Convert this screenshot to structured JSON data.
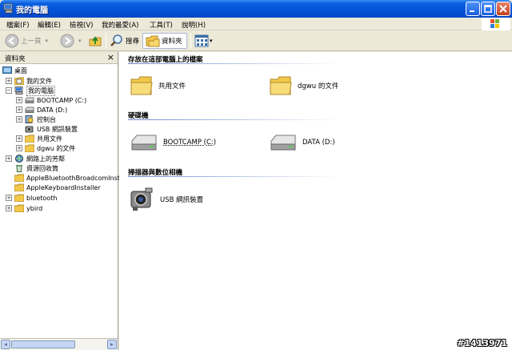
{
  "window": {
    "title": "我的電腦"
  },
  "menu": [
    "檔案(F)",
    "編輯(E)",
    "檢視(V)",
    "我的最愛(A)",
    "工具(T)",
    "說明(H)"
  ],
  "toolbar": {
    "back_label": "上一頁",
    "search_label": "搜尋",
    "folders_label": "資料夾"
  },
  "folders_pane": {
    "title": "資料夾",
    "close_glyph": "×",
    "tree": [
      {
        "label": "桌面",
        "expander": "",
        "icon": "desktop-icon"
      },
      {
        "label": "我的文件",
        "expander": "+",
        "icon": "my-documents-icon"
      },
      {
        "label": "我的電腦",
        "expander": "−",
        "icon": "my-computer-icon",
        "selected": true
      },
      {
        "label": "BOOTCAMP (C:)",
        "expander": "+",
        "icon": "drive-icon"
      },
      {
        "label": "DATA (D:)",
        "expander": "+",
        "icon": "drive-icon"
      },
      {
        "label": "控制台",
        "expander": "+",
        "icon": "control-panel-icon"
      },
      {
        "label": "USB 網訊裝置",
        "expander": "",
        "icon": "camera-icon"
      },
      {
        "label": "共用文件",
        "expander": "+",
        "icon": "folder-icon"
      },
      {
        "label": "dgwu 的文件",
        "expander": "+",
        "icon": "folder-icon"
      },
      {
        "label": "網路上的芳鄰",
        "expander": "+",
        "icon": "network-icon"
      },
      {
        "label": "資源回收筒",
        "expander": "",
        "icon": "recycle-bin-icon"
      },
      {
        "label": "AppleBluetoothBroadcomInstaller",
        "expander": "",
        "icon": "folder-icon"
      },
      {
        "label": "AppleKeyboardInstaller",
        "expander": "",
        "icon": "folder-icon"
      },
      {
        "label": "bluetooth",
        "expander": "+",
        "icon": "folder-icon"
      },
      {
        "label": "ybird",
        "expander": "+",
        "icon": "folder-icon"
      }
    ]
  },
  "content": {
    "groups": [
      {
        "title": "存放在這部電腦上的檔案",
        "items": [
          "共用文件",
          "dgwu 的文件"
        ]
      },
      {
        "title": "硬碟機",
        "items": [
          "BOOTCAMP (C:)",
          "DATA (D:)"
        ]
      },
      {
        "title": "掃描器與數位相機",
        "items": [
          "USB 網訊裝置"
        ]
      }
    ]
  },
  "watermark": "#1413971"
}
